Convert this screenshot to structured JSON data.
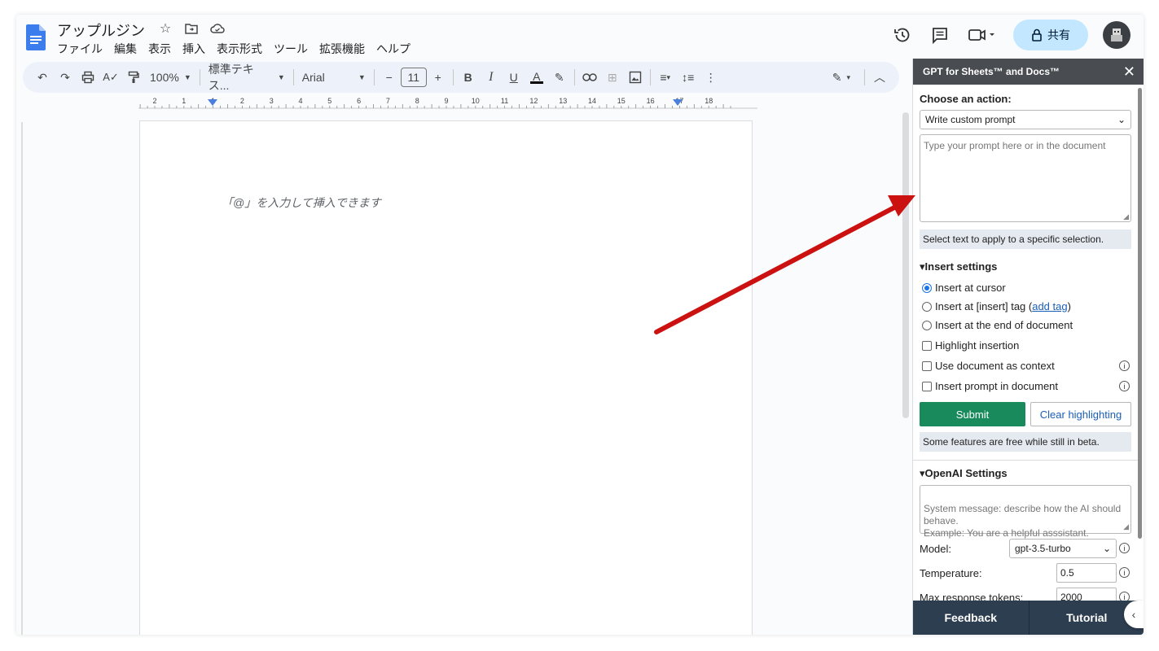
{
  "doc": {
    "title": "アップルジン",
    "menu": [
      "ファイル",
      "編集",
      "表示",
      "挿入",
      "表示形式",
      "ツール",
      "拡張機能",
      "ヘルプ"
    ],
    "share_label": "共有",
    "placeholder": "「@」を入力して挿入できます"
  },
  "toolbar": {
    "zoom": "100%",
    "style": "標準テキス...",
    "font": "Arial",
    "font_size": "11",
    "ruler_numbers": [
      "2",
      "1",
      "1",
      "2",
      "3",
      "4",
      "5",
      "6",
      "7",
      "8",
      "9",
      "10",
      "11",
      "12",
      "13",
      "14",
      "15",
      "16",
      "17",
      "18"
    ]
  },
  "panel": {
    "title": "GPT for Sheets™ and Docs™",
    "choose_action_label": "Choose an action:",
    "action_value": "Write custom prompt",
    "prompt_placeholder": "Type your prompt here or in the document",
    "select_note": "Select text to apply to a specific selection.",
    "insert_settings_title": "▾Insert settings",
    "insert_options": {
      "at_cursor": "Insert at cursor",
      "at_tag_prefix": "Insert at [insert] tag (",
      "add_tag": "add tag",
      "at_tag_suffix": ")",
      "at_end": "Insert at the end of document",
      "highlight": "Highlight insertion",
      "use_context": "Use document as context",
      "insert_prompt": "Insert prompt in document"
    },
    "submit_label": "Submit",
    "clear_label": "Clear highlighting",
    "beta_note": "Some features are free while still in beta.",
    "openai_title": "▾OpenAI Settings",
    "system_message_placeholder": "System message: describe how the AI should behave.\nExample: You are a helpful asssistant.",
    "model_label": "Model:",
    "model_value": "gpt-3.5-turbo",
    "temperature_label": "Temperature:",
    "temperature_value": "0.5",
    "max_tokens_label": "Max response tokens:",
    "max_tokens_value": "2000",
    "feedback_label": "Feedback",
    "tutorial_label": "Tutorial"
  },
  "colors": {
    "accent_blue": "#1a73e8",
    "share_bg": "#c2e7ff",
    "submit_green": "#188a5c",
    "panel_header": "#494c50",
    "footer_navy": "#2d3e50",
    "arrow_red": "#cc1111"
  }
}
